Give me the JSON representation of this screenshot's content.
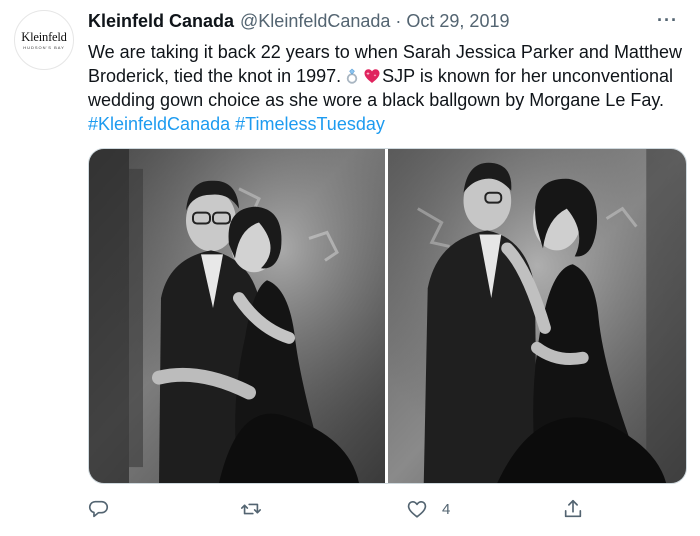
{
  "account": {
    "avatar_name": "Kleinfeld",
    "avatar_sub": "HUDSON'S BAY",
    "display_name": "Kleinfeld Canada",
    "handle": "@KleinfeldCanada",
    "separator": "·",
    "date": "Oct 29, 2019"
  },
  "tweet": {
    "text_part1": "We are taking it back 22 years to when Sarah Jessica Parker and Matthew Broderick, tied the knot in 1997.",
    "text_part2": "SJP is known for her unconventional wedding gown choice as she wore a black ballgown by Morgane Le Fay.",
    "hashtags": [
      "#KleinfeldCanada",
      "#TimelessTuesday"
    ],
    "emojis": [
      "ring-emoji",
      "sparkling-heart-emoji"
    ]
  },
  "media": {
    "photos": [
      "photo-couple-embracing-facing-camera",
      "photo-couple-embracing-facing-each-other"
    ]
  },
  "actions": {
    "reply_count": "",
    "retweet_count": "",
    "like_count": "4",
    "more_label": "···"
  },
  "colors": {
    "link": "#1d9bf0",
    "secondary_text": "#536471",
    "border": "#cfd9de"
  }
}
